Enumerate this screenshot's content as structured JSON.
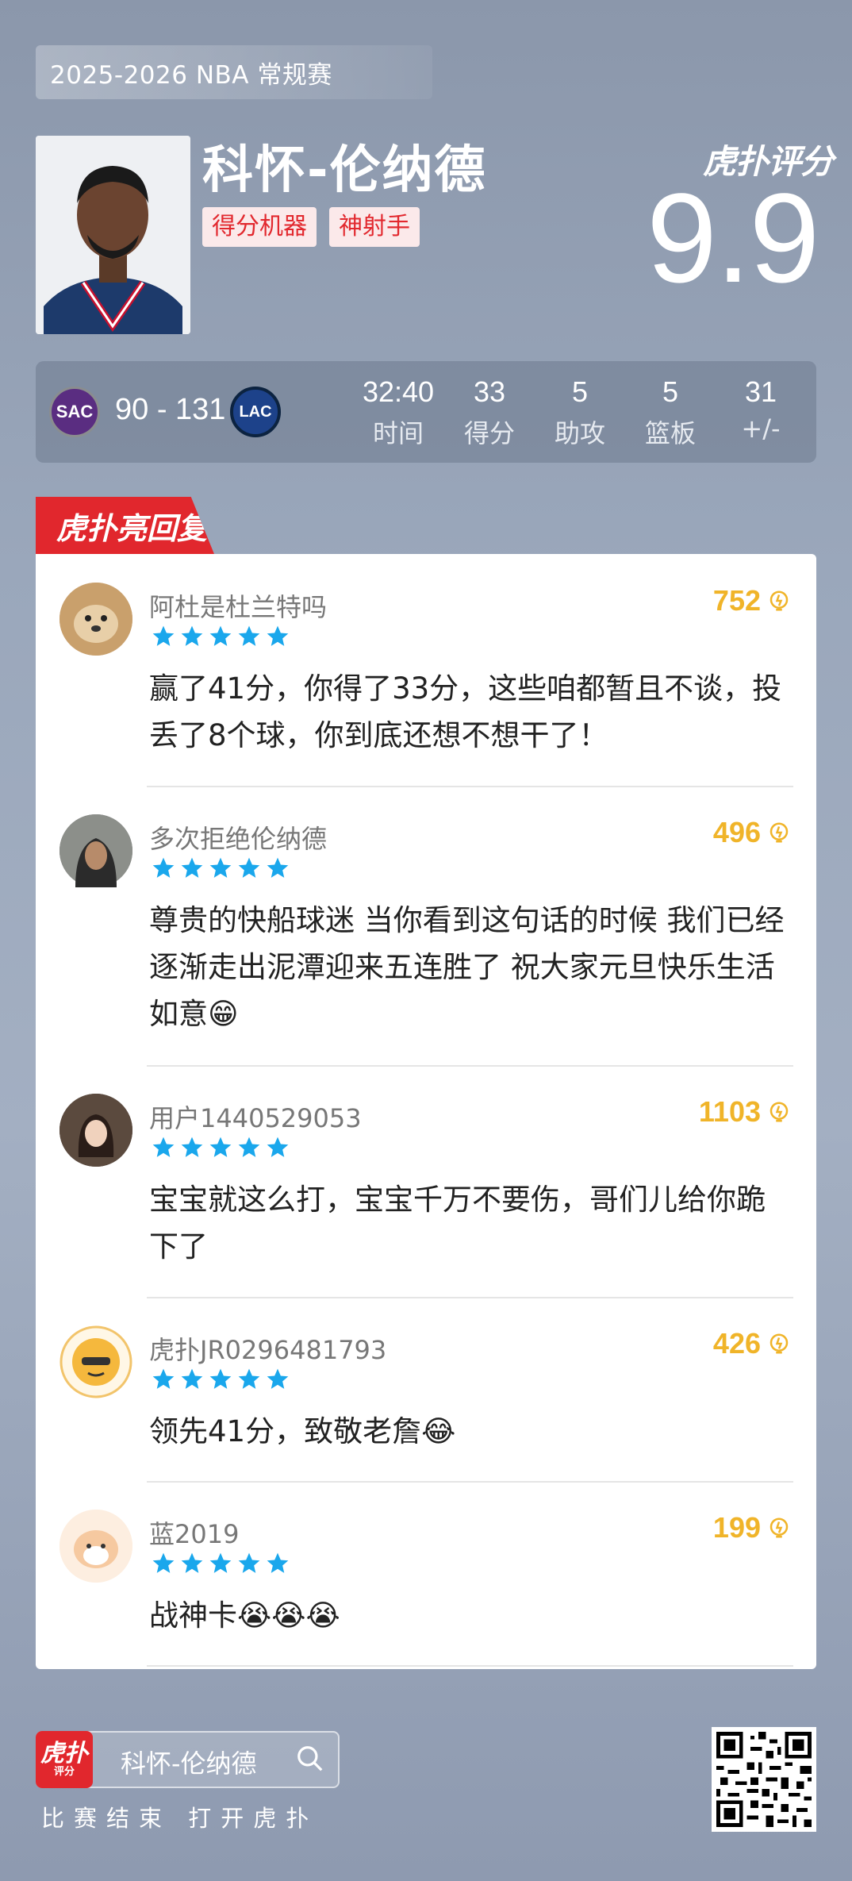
{
  "season": "2025-2026 NBA 常规赛",
  "player": {
    "name": "科怀-伦纳德",
    "tags": [
      "得分机器",
      "神射手"
    ]
  },
  "rating": {
    "brand": "虎扑评分",
    "score": "9.9"
  },
  "game": {
    "home_team": "SAC",
    "away_team": "LAC",
    "score": "90 - 131",
    "stats": [
      {
        "value": "32:40",
        "label": "时间"
      },
      {
        "value": "33",
        "label": "得分"
      },
      {
        "value": "5",
        "label": "助攻"
      },
      {
        "value": "5",
        "label": "篮板"
      },
      {
        "value": "31",
        "label": "+/-"
      }
    ]
  },
  "highlights_tab": "虎扑亮回复",
  "comments": [
    {
      "user": "阿杜是杜兰特吗",
      "likes": "752",
      "stars": 5,
      "text": "赢了41分，你得了33分，这些咱都暂且不谈，投丢了8个球，你到底还想不想干了！"
    },
    {
      "user": "多次拒绝伦纳德",
      "likes": "496",
      "stars": 5,
      "text": "尊贵的快船球迷 当你看到这句话的时候 我们已经逐渐走出泥潭迎来五连胜了 祝大家元旦快乐生活如意😁"
    },
    {
      "user": "用户1440529053",
      "likes": "1103",
      "stars": 5,
      "text": "宝宝就这么打，宝宝千万不要伤，哥们儿给你跪下了"
    },
    {
      "user": "虎扑JR0296481793",
      "likes": "426",
      "stars": 5,
      "text": "领先41分，致敬老詹😂"
    },
    {
      "user": "蓝2019",
      "likes": "199",
      "stars": 5,
      "text": "战神卡😭😭😭"
    }
  ],
  "footer": {
    "app_logo_main": "虎扑",
    "app_logo_sub": "评分",
    "search_text": "科怀-伦纳德",
    "hint": "比赛结束 打开虎扑"
  },
  "colors": {
    "brand_red": "#e1272d",
    "star_blue": "#1aa7ec",
    "likes_gold": "#f0b429"
  }
}
